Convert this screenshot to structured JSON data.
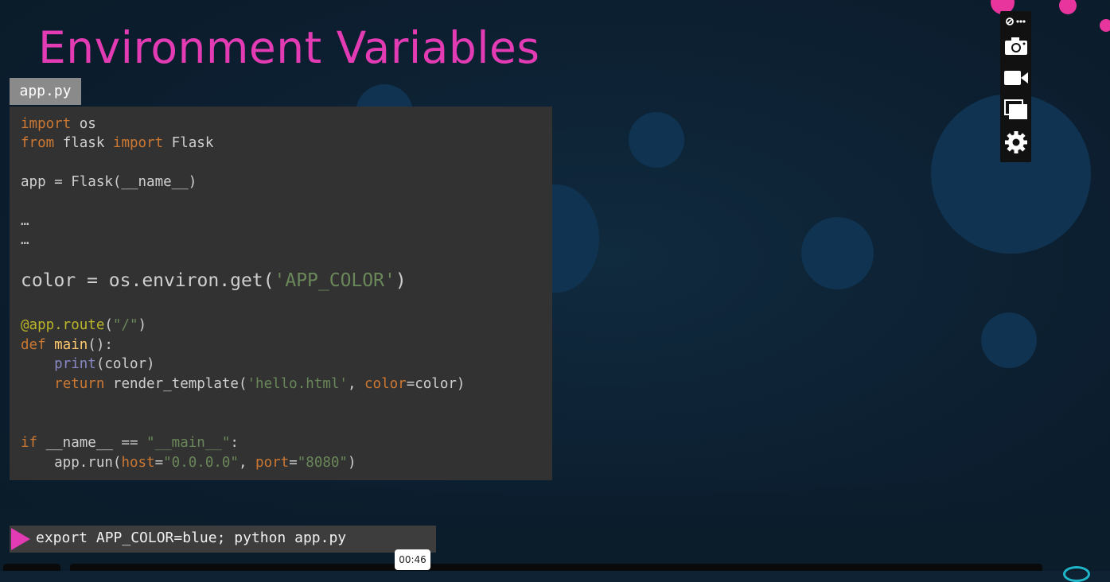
{
  "slide": {
    "title": "Environment Variables",
    "file_tab": "app.py"
  },
  "code": {
    "l1_kw": "import",
    "l1_rest": " os",
    "l2_kw1": "from",
    "l2_mid": " flask ",
    "l2_kw2": "import",
    "l2_rest": " Flask",
    "l3": "app = Flask(__name__)",
    "l4": "…",
    "l5": "…",
    "l6_pre": "color = os.environ.get(",
    "l6_str": "'APP_COLOR'",
    "l6_post": ")",
    "l7_dec": "@app.route",
    "l7_open": "(",
    "l7_str": "\"/\"",
    "l7_close": ")",
    "l8_kw": "def",
    "l8_fn": " main",
    "l8_rest": "():",
    "l9_indent": "    ",
    "l9_bi": "print",
    "l9_rest": "(color)",
    "l10_indent": "    ",
    "l10_kw": "return",
    "l10_mid": " render_template(",
    "l10_str": "'hello.html'",
    "l10_comma": ", ",
    "l10_param": "color",
    "l10_rest": "=color)",
    "l11_kw": "if",
    "l11_mid": " __name__ == ",
    "l11_str": "\"__main__\"",
    "l11_rest": ":",
    "l12_pre": "    app.run(",
    "l12_p1": "host",
    "l12_eq1": "=",
    "l12_s1": "\"0.0.0.0\"",
    "l12_comma": ", ",
    "l12_p2": "port",
    "l12_eq2": "=",
    "l12_s2": "\"8080\"",
    "l12_close": ")"
  },
  "terminal": {
    "command": "export APP_COLOR=blue; python app.py"
  },
  "player": {
    "time": "00:46"
  },
  "toolbar": {
    "icons": [
      "link-more-icon",
      "camera-icon",
      "video-icon",
      "window-icon",
      "gear-icon"
    ]
  },
  "colors": {
    "accent_pink": "#e23bb4",
    "code_bg": "#323232",
    "keyword": "#cc7832",
    "string": "#6a8759",
    "background": "#0e2233"
  }
}
